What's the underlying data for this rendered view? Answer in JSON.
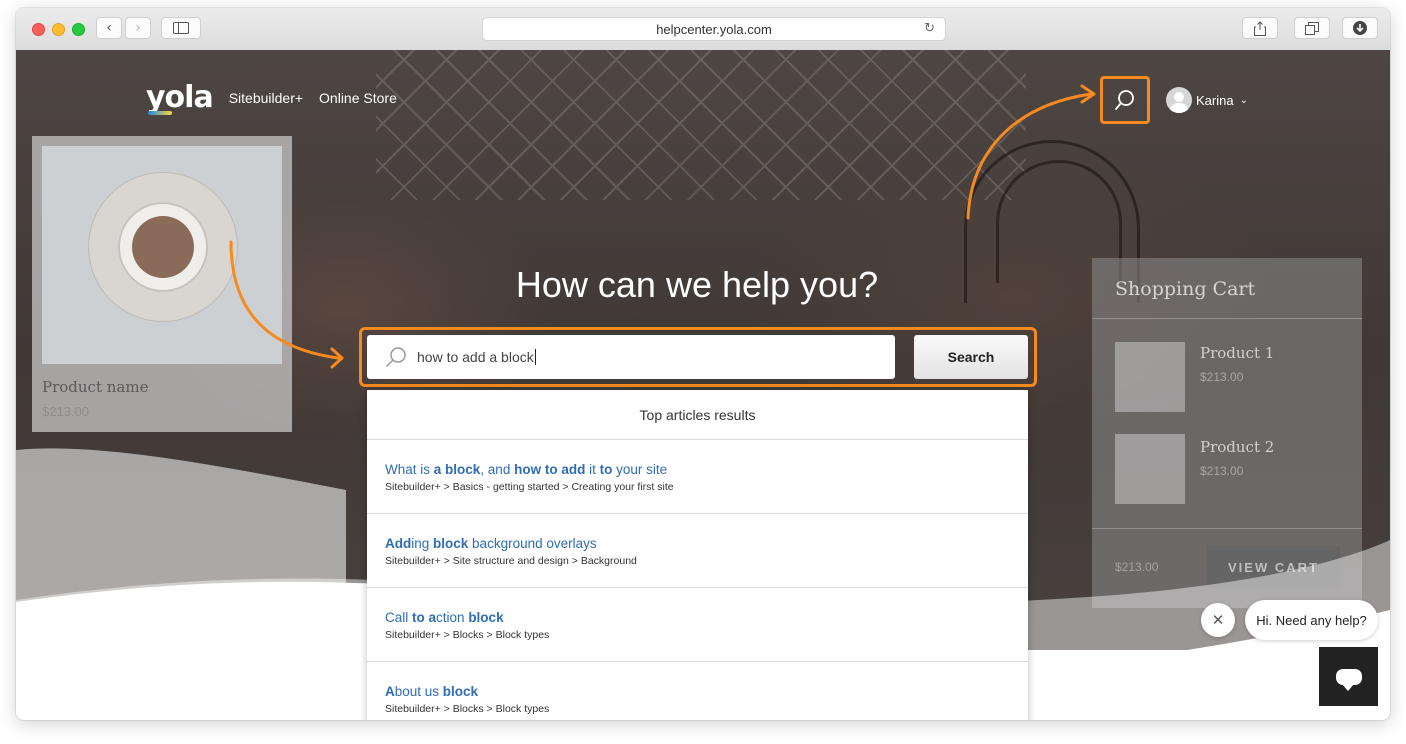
{
  "browser": {
    "url": "helpcenter.yola.com",
    "back_glyph": "‹",
    "forward_glyph": "›",
    "reload_glyph": "↻"
  },
  "nav": {
    "logo": "yola",
    "links": [
      "Sitebuilder+",
      "Online Store"
    ],
    "user_name": "Karina",
    "user_chevron": "⌄"
  },
  "hero": {
    "headline": "How can we help you?"
  },
  "search": {
    "query": "how to add a block",
    "button_label": "Search"
  },
  "results": {
    "header": "Top articles results",
    "items": [
      {
        "title_html": "What is <b>a block</b>, and <b>how to add</b> it <b>to</b> your site",
        "path": "Sitebuilder+ > Basics - getting started > Creating your first site"
      },
      {
        "title_html": "<b>Add</b>ing <b>block</b> background overlays",
        "path": "Sitebuilder+ > Site structure and design > Background"
      },
      {
        "title_html": "Call <b>to a</b>ction <b>block</b>",
        "path": "Sitebuilder+ > Blocks > Block types"
      },
      {
        "title_html": "<b>A</b>bout us <b>block</b>",
        "path": "Sitebuilder+ > Blocks > Block types"
      }
    ]
  },
  "product_card": {
    "name": "Product name",
    "price": "$213.00"
  },
  "cart": {
    "title": "Shopping Cart",
    "items": [
      {
        "name": "Product 1",
        "price": "$213.00"
      },
      {
        "name": "Product 2",
        "price": "$213.00"
      }
    ],
    "total": "$213.00",
    "button": "VIEW CART"
  },
  "chat": {
    "close_glyph": "✕",
    "greeting": "Hi. Need any help?"
  },
  "colors": {
    "highlight": "#f68a1e",
    "link": "#2f6db5"
  }
}
